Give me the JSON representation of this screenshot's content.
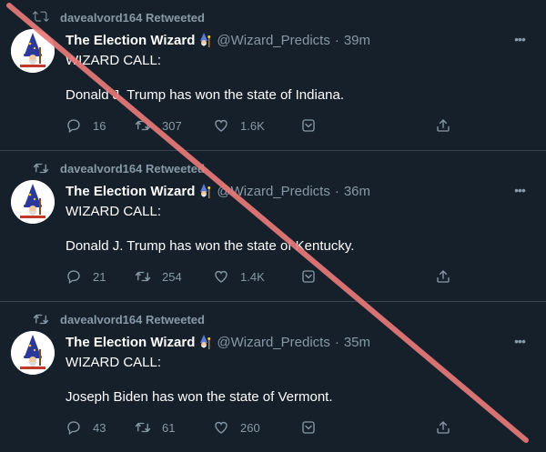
{
  "colors": {
    "background": "#15202b",
    "divider": "#38444d",
    "muted_text": "#8899a6",
    "primary_text": "#ffffff",
    "slash_line": "#e87a7a"
  },
  "icons": {
    "retweet_header": "retweet-icon",
    "reply": "reply-icon",
    "retweet": "retweet-icon",
    "like": "heart-icon",
    "share": "share-icon",
    "upload": "upload-icon",
    "more": "more-icon",
    "avatar": "wizard-avatar",
    "name_emoji": "mage-emoji"
  },
  "tweets": [
    {
      "retweeted_by": "davealvord164 Retweeted",
      "display_name": "The Election Wizard",
      "handle": "@Wizard_Predicts",
      "separator": "·",
      "time": "39m",
      "more": "•••",
      "line1": "WIZARD CALL:",
      "line2": "Donald J. Trump has won the state of Indiana.",
      "replies": "16",
      "retweets": "307",
      "likes": "1.6K"
    },
    {
      "retweeted_by": "davealvord164 Retweeted",
      "display_name": "The Election Wizard",
      "handle": "@Wizard_Predicts",
      "separator": "·",
      "time": "36m",
      "more": "•••",
      "line1": "WIZARD CALL:",
      "line2": "Donald J. Trump has won the state of Kentucky.",
      "replies": "21",
      "retweets": "254",
      "likes": "1.4K"
    },
    {
      "retweeted_by": "davealvord164 Retweeted",
      "display_name": "The Election Wizard",
      "handle": "@Wizard_Predicts",
      "separator": "·",
      "time": "35m",
      "more": "•••",
      "line1": "WIZARD CALL:",
      "line2": "Joseph Biden has won the state of Vermont.",
      "replies": "43",
      "retweets": "61",
      "likes": "260"
    }
  ]
}
